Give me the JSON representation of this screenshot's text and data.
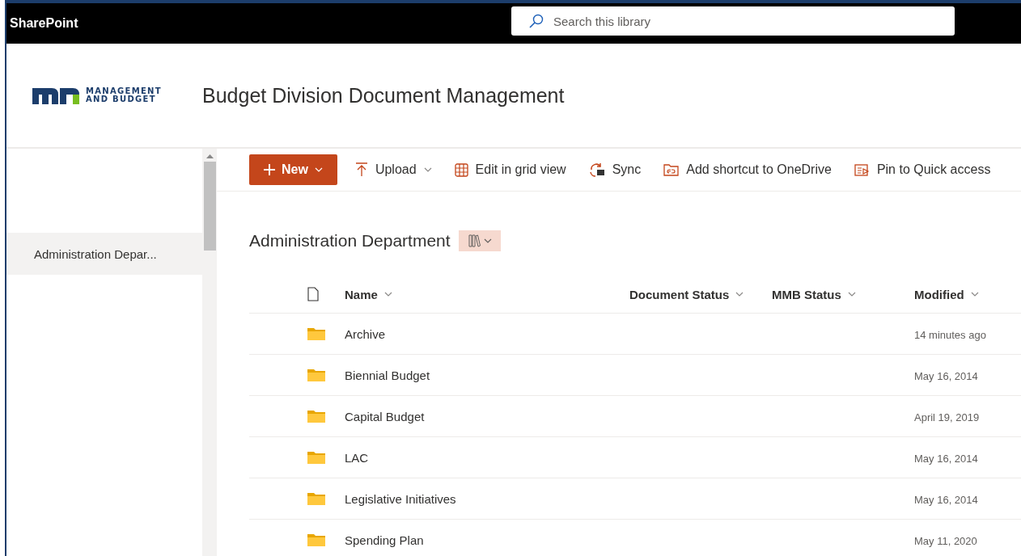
{
  "app_bar": {
    "title": "SharePoint",
    "search": {
      "placeholder": "Search this library"
    }
  },
  "header": {
    "logo_lines": [
      "MANAGEMENT",
      "AND BUDGET"
    ],
    "site_title": "Budget Division Document Management"
  },
  "sidebar": {
    "items": [
      {
        "label": "Administration Depar...",
        "selected": true
      }
    ]
  },
  "command_bar": [
    {
      "kind": "new",
      "label": "New"
    },
    {
      "kind": "upload",
      "label": "Upload"
    },
    {
      "kind": "grid",
      "label": "Edit in grid view"
    },
    {
      "kind": "sync",
      "label": "Sync"
    },
    {
      "kind": "shortcut",
      "label": "Add shortcut to OneDrive"
    },
    {
      "kind": "pin",
      "label": "Pin to Quick access"
    }
  ],
  "library": {
    "title": "Administration Department",
    "columns": [
      "Name",
      "Document Status",
      "MMB Status",
      "Modified"
    ],
    "rows": [
      {
        "name": "Archive",
        "modified": "14 minutes ago"
      },
      {
        "name": "Biennial Budget",
        "modified": "May 16, 2014"
      },
      {
        "name": "Capital Budget",
        "modified": "April 19, 2019"
      },
      {
        "name": "LAC",
        "modified": "May 16, 2014"
      },
      {
        "name": "Legislative Initiatives",
        "modified": "May 16, 2014"
      },
      {
        "name": "Spending Plan",
        "modified": "May 11, 2020"
      }
    ]
  }
}
